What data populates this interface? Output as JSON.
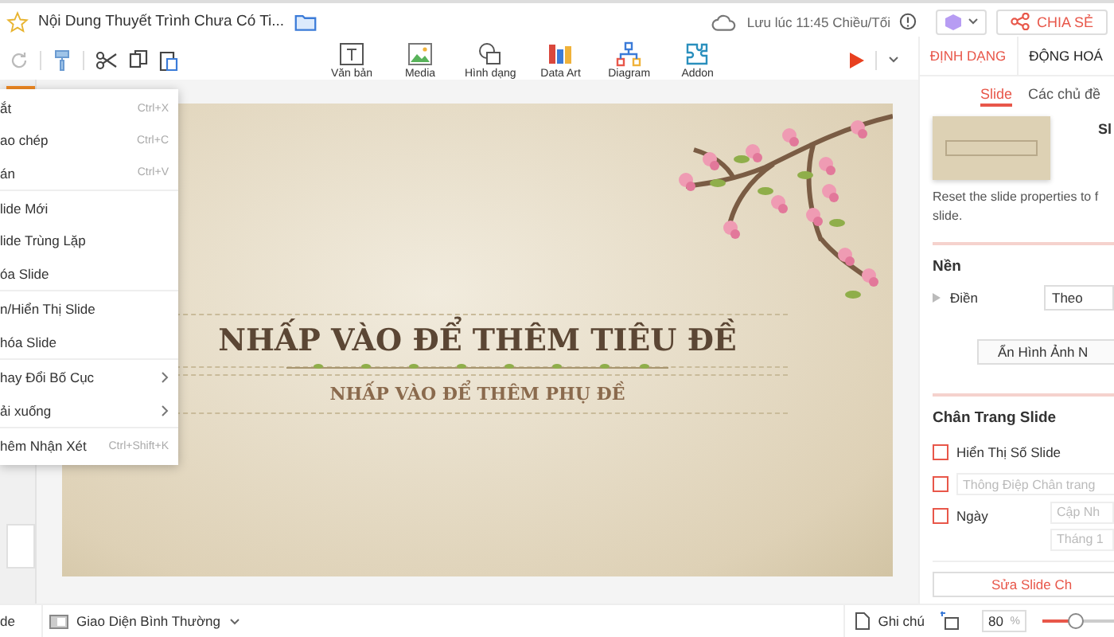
{
  "header": {
    "title": "Nội Dung Thuyết Trình Chưa Có Ti...",
    "save_status": "Lưu lúc 11:45 Chiều/Tối",
    "share_label": "CHIA SẺ"
  },
  "toolbar": {
    "tools": [
      {
        "label": "Văn bản"
      },
      {
        "label": "Media"
      },
      {
        "label": "Hình dạng"
      },
      {
        "label": "Data Art"
      },
      {
        "label": "Diagram"
      },
      {
        "label": "Addon"
      }
    ]
  },
  "thumbnails": [
    {
      "selected": true
    }
  ],
  "context_menu": [
    {
      "label": "ắt",
      "shortcut": "Ctrl+X",
      "submenu": false,
      "divider_after": false
    },
    {
      "label": "ao chép",
      "shortcut": "Ctrl+C",
      "submenu": false,
      "divider_after": false
    },
    {
      "label": "án",
      "shortcut": "Ctrl+V",
      "submenu": false,
      "divider_after": true
    },
    {
      "label": "lide Mới",
      "submenu": false,
      "divider_after": false
    },
    {
      "label": "lide Trùng Lặp",
      "submenu": false,
      "divider_after": false
    },
    {
      "label": "óa Slide",
      "submenu": false,
      "divider_after": true
    },
    {
      "label": "n/Hiển Thị Slide",
      "submenu": false,
      "divider_after": false
    },
    {
      "label": "hóa Slide",
      "submenu": false,
      "divider_after": true
    },
    {
      "label": "hay Đổi Bố Cục",
      "submenu": true,
      "divider_after": false
    },
    {
      "label": "ải xuống",
      "submenu": true,
      "divider_after": true
    },
    {
      "label": "hêm Nhận Xét",
      "shortcut": "Ctrl+Shift+K",
      "submenu": false,
      "divider_after": false
    }
  ],
  "slide": {
    "title_placeholder": "NHẤP VÀO ĐỂ THÊM TIÊU ĐỀ",
    "subtitle_placeholder": "NHẤP VÀO ĐỂ THÊM PHỤ ĐỀ"
  },
  "panel": {
    "tabs": [
      {
        "label": "ĐỊNH DẠNG",
        "selected": true
      },
      {
        "label": "ĐỘNG HOÁ",
        "selected": false
      }
    ],
    "subtabs": [
      {
        "label": "Slide",
        "selected": true
      },
      {
        "label": "Các chủ đề",
        "selected": false
      }
    ],
    "layout_label": "Sl",
    "description_lines": [
      "Reset the slide properties to f",
      "slide."
    ],
    "background": {
      "heading": "Nền",
      "fill_label": "Điền",
      "fill_value": "Theo",
      "hide_button": "Ẩn Hình Ảnh N"
    },
    "footer": {
      "heading": "Chân Trang Slide",
      "options": [
        {
          "kind": "label",
          "label": "Hiển Thị Số Slide",
          "checked": false
        },
        {
          "kind": "field",
          "placeholder": "Thông Điệp Chân trang",
          "checked": false
        },
        {
          "kind": "date",
          "label": "Ngày",
          "checked": false,
          "fields": [
            {
              "placeholder": "Cập Nh"
            },
            {
              "placeholder": "Tháng 1"
            }
          ]
        }
      ]
    },
    "edit_button": "Sửa Slide Ch"
  },
  "status_bar": {
    "slide_label": "de",
    "view_label": "Giao Diện Bình Thường",
    "notes_label": "Ghi chú",
    "zoom": "80",
    "zoom_unit": "%",
    "zoom_slider": {
      "level": 0.35
    }
  }
}
